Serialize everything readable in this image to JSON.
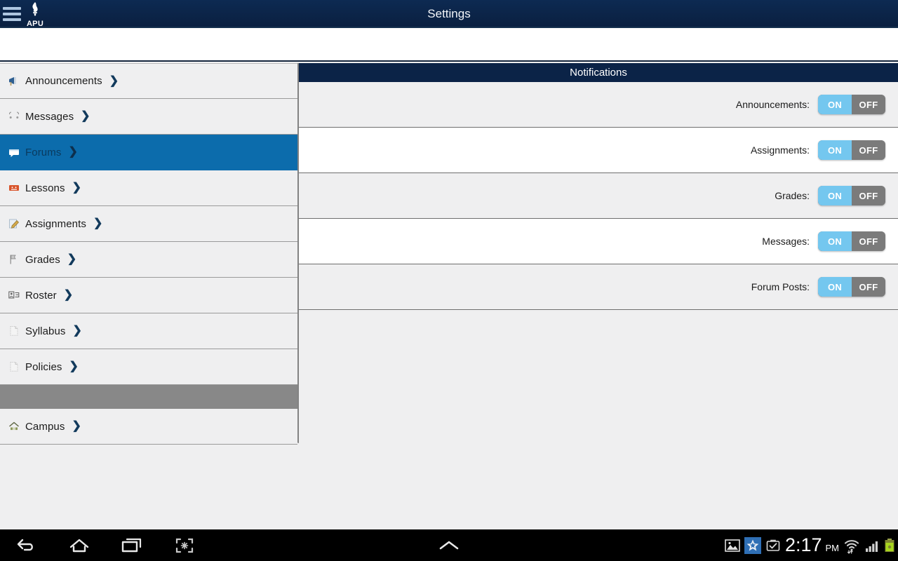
{
  "titlebar": {
    "title": "Settings",
    "menu_icon": "hamburger-menu-icon",
    "logo_text": "APU",
    "logo_icon": "torch-logo-icon",
    "bg_color": "#0b2347"
  },
  "sidebar": {
    "items": [
      {
        "label": "Announcements",
        "icon": "announcements-megaphone-icon",
        "chevron": "❯",
        "selected": false,
        "type": "item"
      },
      {
        "label": "Messages",
        "icon": "messages-envelope-icon",
        "chevron": "❯",
        "selected": false,
        "type": "item"
      },
      {
        "label": "Forums",
        "icon": "forums-chat-icon",
        "chevron": "❯",
        "selected": true,
        "type": "item"
      },
      {
        "label": "Lessons",
        "icon": "lessons-book-icon",
        "chevron": "❯",
        "selected": false,
        "type": "item"
      },
      {
        "label": "Assignments",
        "icon": "assignments-pencil-icon",
        "chevron": "❯",
        "selected": false,
        "type": "item"
      },
      {
        "label": "Grades",
        "icon": "grades-flag-icon",
        "chevron": "❯",
        "selected": false,
        "type": "item"
      },
      {
        "label": "Roster",
        "icon": "roster-people-icon",
        "chevron": "❯",
        "selected": false,
        "type": "item"
      },
      {
        "label": "Syllabus",
        "icon": "syllabus-document-icon",
        "chevron": "❯",
        "selected": false,
        "type": "item"
      },
      {
        "label": "Policies",
        "icon": "policies-document-icon",
        "chevron": "❯",
        "selected": false,
        "type": "item"
      },
      {
        "label": "",
        "icon": "",
        "chevron": "",
        "selected": false,
        "type": "spacer"
      },
      {
        "label": "Campus",
        "icon": "campus-home-icon",
        "chevron": "❯",
        "selected": false,
        "type": "item"
      }
    ],
    "selected_color": "#0c6cac",
    "spacer_color": "#888888"
  },
  "panel": {
    "header": "Notifications",
    "toggle_on_label": "ON",
    "toggle_off_label": "OFF",
    "on_color": "#74c7ef",
    "off_color": "#7b7b7b",
    "rows": [
      {
        "label": "Announcements:",
        "state": "ON"
      },
      {
        "label": "Assignments:",
        "state": "ON"
      },
      {
        "label": "Grades:",
        "state": "ON"
      },
      {
        "label": "Messages:",
        "state": "ON"
      },
      {
        "label": "Forum Posts:",
        "state": "ON"
      }
    ]
  },
  "navbar": {
    "buttons": [
      {
        "name": "back-icon"
      },
      {
        "name": "home-icon"
      },
      {
        "name": "recent-apps-icon"
      },
      {
        "name": "screenshot-icon"
      }
    ],
    "center": {
      "name": "chevron-up-icon"
    },
    "status": {
      "gallery_icon": "gallery-image-icon",
      "star_icon": "star-app-icon",
      "briefcase_icon": "briefcase-check-icon",
      "time": "2:17",
      "ampm": "PM",
      "wifi_icon": "wifi-icon",
      "signal_icon": "cellular-signal-icon",
      "battery_icon": "battery-icon"
    }
  }
}
